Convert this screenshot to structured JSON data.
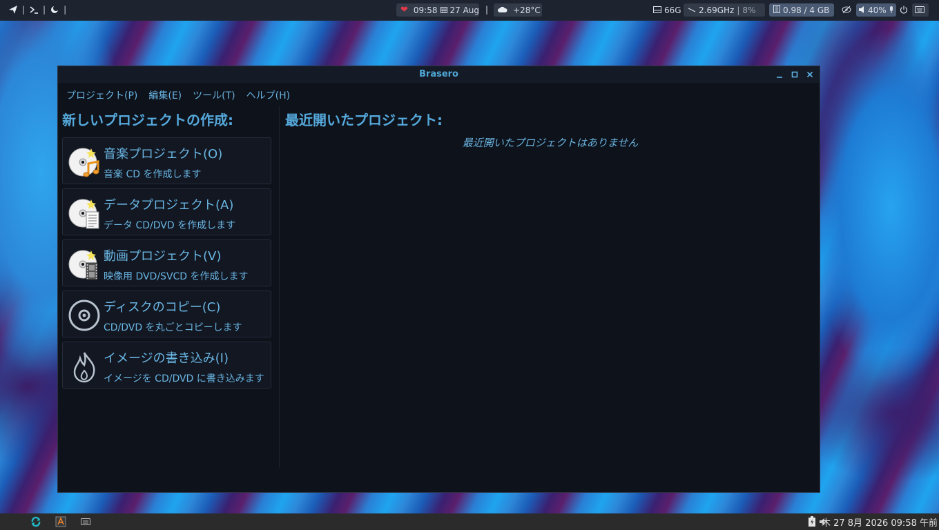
{
  "top_panel": {
    "time": "09:58",
    "date": "27 Aug",
    "separator": "|",
    "weather": "+28°C",
    "disk": "66G",
    "cpu_freq": "2.69GHz",
    "cpu_sep": "|",
    "cpu_load": "8%",
    "memory": "0.98 / 4 GB",
    "volume": "40%"
  },
  "window": {
    "title": "Brasero",
    "menu": [
      "プロジェクト(P)",
      "編集(E)",
      "ツール(T)",
      "ヘルプ(H)"
    ],
    "new_project_heading": "新しいプロジェクトの作成:",
    "recent_heading": "最近開いたプロジェクト:",
    "recent_empty": "最近開いたプロジェクトはありません",
    "projects": [
      {
        "title": "音楽プロジェクト(O)",
        "subtitle": "音楽 CD を作成します",
        "icon": "audio-disc-icon"
      },
      {
        "title": "データプロジェクト(A)",
        "subtitle": "データ CD/DVD を作成します",
        "icon": "data-disc-icon"
      },
      {
        "title": "動画プロジェクト(V)",
        "subtitle": "映像用 DVD/SVCD を作成します",
        "icon": "video-disc-icon"
      },
      {
        "title": "ディスクのコピー(C)",
        "subtitle": "CD/DVD を丸ごとコピーします",
        "icon": "disc-copy-icon"
      },
      {
        "title": "イメージの書き込み(I)",
        "subtitle": "イメージを CD/DVD に書き込みます",
        "icon": "burn-image-icon"
      }
    ]
  },
  "bottom_panel": {
    "clock": "木 27  8月 2026 09:58 午前"
  },
  "colors": {
    "accent": "#55a9dc",
    "window_bg": "#0e121b",
    "panel_bg": "#1d2430"
  }
}
